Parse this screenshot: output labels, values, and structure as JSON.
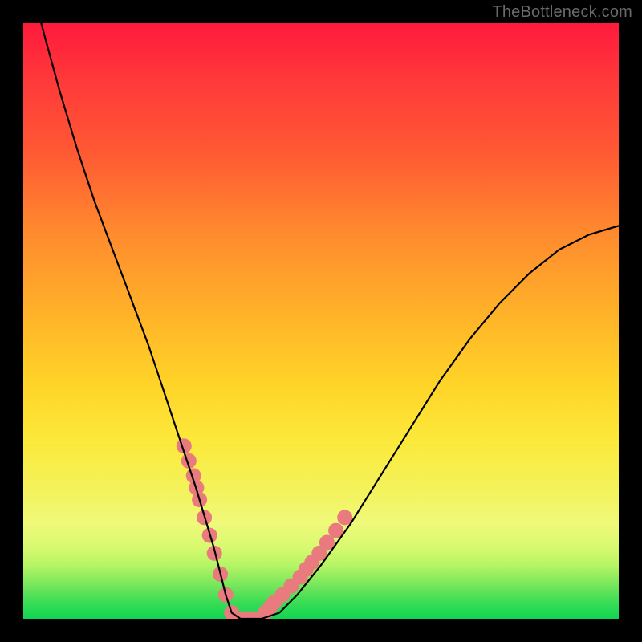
{
  "attribution": "TheBottleneck.com",
  "chart_data": {
    "type": "line",
    "title": "",
    "xlabel": "",
    "ylabel": "",
    "xlim": [
      0,
      100
    ],
    "ylim": [
      0,
      100
    ],
    "grid": false,
    "legend": false,
    "series": [
      {
        "name": "curve",
        "color": "#000000",
        "x": [
          3,
          6,
          9,
          12,
          15,
          18,
          21,
          23,
          25,
          27,
          29,
          30.5,
          32,
          33,
          34,
          35,
          36.5,
          38,
          40,
          43,
          46,
          50,
          55,
          60,
          65,
          70,
          75,
          80,
          85,
          90,
          95,
          100
        ],
        "y": [
          100,
          89,
          79,
          70,
          62,
          54,
          46,
          40,
          34,
          28,
          22,
          17,
          12,
          8,
          4,
          1,
          0,
          0,
          0,
          1,
          4,
          9,
          16,
          24,
          32,
          40,
          47,
          53,
          58,
          62,
          64.5,
          66
        ]
      },
      {
        "name": "dots",
        "type": "scatter",
        "color": "#e97a7d",
        "x": [
          27.0,
          27.8,
          28.6,
          29.1,
          29.6,
          30.4,
          31.3,
          32.1,
          33.1,
          34.0,
          35.0,
          36.0,
          37.1,
          38.4,
          39.7,
          40.6,
          41.5,
          42.2,
          43.5,
          45.0,
          46.5,
          47.5,
          48.5,
          49.7,
          51.0,
          52.5,
          54.0
        ],
        "y": [
          29.0,
          26.5,
          24.0,
          22.0,
          20.0,
          17.0,
          14.0,
          11.0,
          7.5,
          4.0,
          1.0,
          0.0,
          0.0,
          0.0,
          0.0,
          1.0,
          2.0,
          2.8,
          4.0,
          5.5,
          7.0,
          8.3,
          9.5,
          11.0,
          12.8,
          14.8,
          17.0
        ]
      }
    ]
  }
}
